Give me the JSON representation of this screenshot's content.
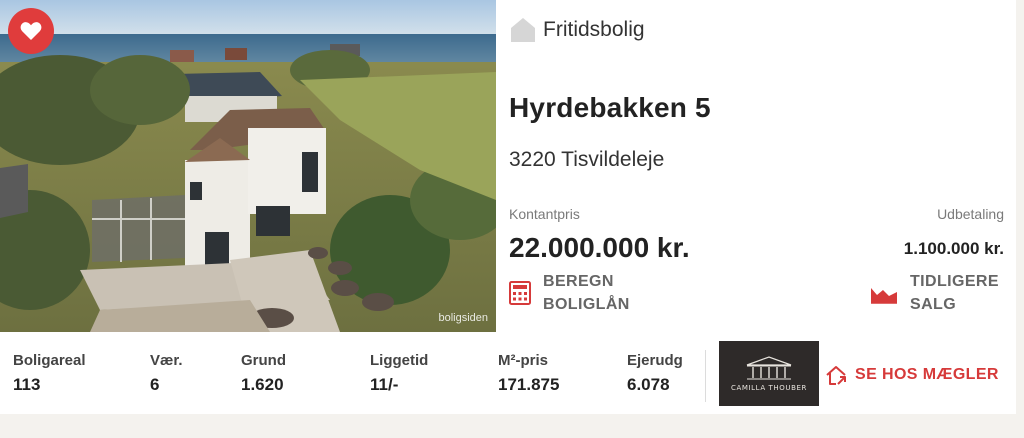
{
  "listing": {
    "photo_watermark": "boligsiden",
    "property_type": "Fritidsbolig",
    "address": "Hyrdebakken 5",
    "city": "3220 Tisvildeleje",
    "price_label": "Kontantpris",
    "price_value": "22.000.000 kr.",
    "payment_label": "Udbetaling",
    "payment_value": "1.100.000 kr.",
    "calc_loan_label": "BEREGN\nBOLIGLÅN",
    "previous_sales_label": "TIDLIGERE\nSALG"
  },
  "stats": [
    {
      "label": "Boligareal",
      "value": "113"
    },
    {
      "label": "Vær.",
      "value": "6"
    },
    {
      "label": "Grund",
      "value": "1.620"
    },
    {
      "label": "Liggetid",
      "value": "11/-"
    },
    {
      "label": "M²-pris",
      "value": "171.875"
    },
    {
      "label": "Ejerudg",
      "value": "6.078"
    }
  ],
  "broker": {
    "logo_text": "CAMILLA THOUBER",
    "cta_label": "SE HOS MÆGLER"
  },
  "icons": {
    "favorite": "heart-icon",
    "type": "house-icon",
    "calculator": "calculator-icon",
    "sales_chart": "area-chart-icon",
    "broker_link": "house-link-icon"
  },
  "colors": {
    "accent": "#e03c3c",
    "cta_red": "#d63a3a",
    "muted": "#7a7a7a",
    "background": "#f4f2ee"
  }
}
